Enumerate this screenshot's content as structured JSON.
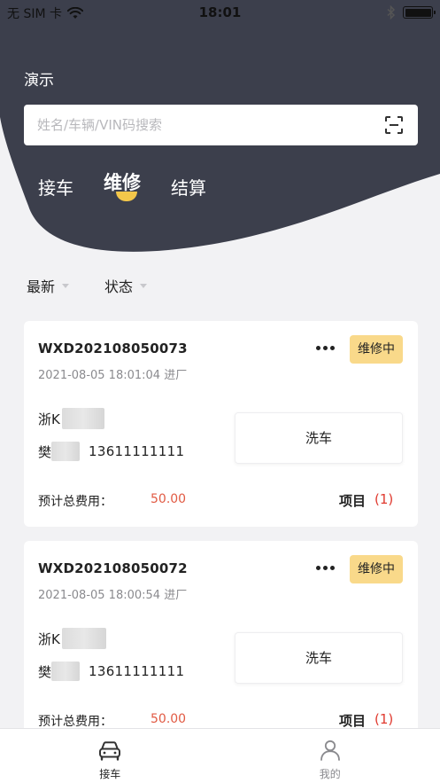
{
  "status_bar": {
    "carrier": "无 SIM 卡",
    "time": "18:01"
  },
  "header": {
    "title": "演示",
    "search": {
      "placeholder": "姓名/车辆/VIN码搜索",
      "value": ""
    },
    "tabs": [
      {
        "label": "接车",
        "active": false
      },
      {
        "label": "维修",
        "active": true
      },
      {
        "label": "结算",
        "active": false
      }
    ]
  },
  "filters": [
    {
      "label": "最新"
    },
    {
      "label": "状态"
    }
  ],
  "orders": [
    {
      "order_no": "WXD202108050073",
      "time": "2021-08-05 18:01:04 进厂",
      "status": "维修中",
      "plate_prefix": "浙K",
      "owner_prefix": "樊",
      "phone": "13611111111",
      "service": "洗车",
      "cost_label": "预计总费用：",
      "cost": "50.00",
      "items_label": "项目",
      "items_count": "(1)"
    },
    {
      "order_no": "WXD202108050072",
      "time": "2021-08-05 18:00:54 进厂",
      "status": "维修中",
      "plate_prefix": "浙K",
      "owner_prefix": "樊",
      "phone": "13611111111",
      "service": "洗车",
      "cost_label": "预计总费用：",
      "cost": "50.00",
      "items_label": "项目",
      "items_count": "(1)"
    }
  ],
  "tabbar": [
    {
      "label": "接车",
      "icon": "car-icon",
      "active": true
    },
    {
      "label": "我的",
      "icon": "user-icon",
      "active": false
    }
  ],
  "colors": {
    "header_bg": "#3c3f4c",
    "accent": "#f4c74a",
    "badge_bg": "#f9d98a",
    "cost_red": "#e15a43"
  }
}
